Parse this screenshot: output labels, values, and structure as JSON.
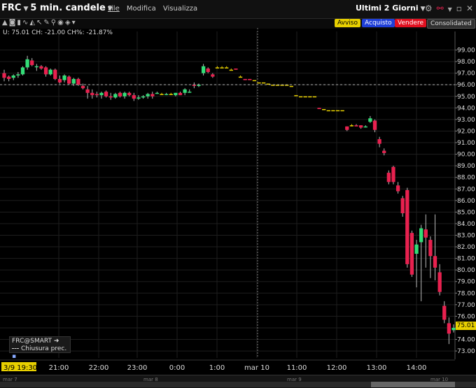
{
  "header": {
    "symbol": "FRC",
    "bar_size": "5 min. candele",
    "menus": [
      "File",
      "Modifica",
      "Visualizza"
    ],
    "range": "Ultimi 2 Giorni"
  },
  "buttons": {
    "alert": "Avviso",
    "buy": "Acquisto",
    "sell": "Vendere",
    "consolidated": "Consolidated"
  },
  "status": "U: 75.01 CH: -21.00 CH%: -21.87%",
  "legend": {
    "contract": "FRC@SMART",
    "prev_close": "Chiusura prec."
  },
  "current_price_label": "75.01",
  "colors": {
    "up": "#33dd77",
    "down": "#e8214f",
    "doji": "#e8d000",
    "background": "#000000",
    "grid": "#1e1e1e"
  },
  "icons": [
    "crosshair-icon",
    "zoom-icon",
    "bar-icon",
    "line-icon",
    "mountain-icon",
    "pointer-icon",
    "wrench-icon",
    "draw-icon",
    "eye-icon",
    "layout-icon"
  ],
  "timeline": [
    "mar 7",
    "mar 8",
    "mar 9",
    "mar 10"
  ],
  "chart_data": {
    "type": "candlestick",
    "ylim": [
      72.4,
      100.0
    ],
    "y_ticks": [
      "73.00",
      "74.00",
      "75.00",
      "76.00",
      "77.00",
      "78.00",
      "79.00",
      "80.00",
      "81.00",
      "82.00",
      "83.00",
      "84.00",
      "85.00",
      "86.00",
      "87.00",
      "88.00",
      "89.00",
      "90.00",
      "91.00",
      "92.00",
      "93.00",
      "94.00",
      "95.00",
      "96.00",
      "97.00",
      "98.00",
      "99.00"
    ],
    "x_labels": [
      "3/9 19:30",
      "21:00",
      "22:00",
      "23:00",
      "0:00",
      "1:00",
      "mar 10",
      "11:00",
      "12:00",
      "13:00",
      "14:00"
    ],
    "previous_close": 96.01,
    "current_price": 75.01,
    "ohlc": [
      [
        97.0,
        97.3,
        96.3,
        96.6
      ],
      [
        96.7,
        96.8,
        96.3,
        96.5
      ],
      [
        96.6,
        96.9,
        96.4,
        96.8
      ],
      [
        96.8,
        97.1,
        96.6,
        96.9
      ],
      [
        96.9,
        97.6,
        96.8,
        97.5
      ],
      [
        97.5,
        98.5,
        97.3,
        98.2
      ],
      [
        98.1,
        98.3,
        97.6,
        97.7
      ],
      [
        97.6,
        97.8,
        97.2,
        97.6
      ],
      [
        97.6,
        97.7,
        97.3,
        97.4
      ],
      [
        97.5,
        97.6,
        96.7,
        96.9
      ],
      [
        96.9,
        97.4,
        96.8,
        97.3
      ],
      [
        97.3,
        97.4,
        96.4,
        96.5
      ],
      [
        96.5,
        96.8,
        96.1,
        96.2
      ],
      [
        96.4,
        96.9,
        96.2,
        96.8
      ],
      [
        96.7,
        96.8,
        96.0,
        96.1
      ],
      [
        96.1,
        96.6,
        95.9,
        96.5
      ],
      [
        96.5,
        96.6,
        95.9,
        96.0
      ],
      [
        95.9,
        96.1,
        95.6,
        95.7
      ],
      [
        95.6,
        95.9,
        94.8,
        95.3
      ],
      [
        95.3,
        95.6,
        94.8,
        95.1
      ],
      [
        95.2,
        95.4,
        94.9,
        95.1
      ],
      [
        95.1,
        95.4,
        94.8,
        95.3
      ],
      [
        95.4,
        95.5,
        94.9,
        95.0
      ],
      [
        95.0,
        95.3,
        94.7,
        94.9
      ],
      [
        94.9,
        95.3,
        94.8,
        95.2
      ],
      [
        95.3,
        95.4,
        94.9,
        95.0
      ],
      [
        95.0,
        95.4,
        94.8,
        95.3
      ],
      [
        95.3,
        95.4,
        95.0,
        95.1
      ],
      [
        95.1,
        95.3,
        94.6,
        94.8
      ],
      [
        94.8,
        95.1,
        94.7,
        94.9
      ],
      [
        94.9,
        95.1,
        94.8,
        95.0
      ],
      [
        95.0,
        95.3,
        94.8,
        95.2
      ],
      [
        95.2,
        95.4,
        94.8,
        95.0
      ],
      [
        95.3,
        95.4,
        95.2,
        95.3
      ],
      [
        95.2,
        95.3,
        95.2,
        95.2
      ],
      [
        95.2,
        95.3,
        95.1,
        95.2
      ],
      [
        95.2,
        95.3,
        95.2,
        95.2
      ],
      [
        95.1,
        95.3,
        95.0,
        95.3
      ],
      [
        95.3,
        95.4,
        95.1,
        95.1
      ],
      [
        95.3,
        95.7,
        95.1,
        95.6
      ],
      [
        95.4,
        95.6,
        95.3,
        95.4
      ],
      [
        96.0,
        96.2,
        95.7,
        95.9
      ],
      [
        95.9,
        96.1,
        95.8,
        96.0
      ],
      [
        97.0,
        97.8,
        96.8,
        97.6
      ],
      [
        97.4,
        97.5,
        97.0,
        97.1
      ],
      [
        96.9,
        97.0,
        96.6,
        96.7
      ],
      [
        97.5,
        97.6,
        97.5,
        97.5
      ],
      [
        97.5,
        97.6,
        97.5,
        97.5
      ],
      [
        97.5,
        97.6,
        97.5,
        97.5
      ],
      [
        97.3,
        97.4,
        97.3,
        97.3
      ],
      [
        97.4,
        97.4,
        97.3,
        97.3
      ],
      [
        96.7,
        96.8,
        96.7,
        96.7
      ],
      [
        96.5,
        96.5,
        96.4,
        96.4
      ],
      [
        96.5,
        96.5,
        96.4,
        96.4
      ],
      [
        96.4,
        96.4,
        96.4,
        96.4
      ],
      [
        96.2,
        96.2,
        96.2,
        96.2
      ],
      [
        96.2,
        96.2,
        96.2,
        96.2
      ],
      [
        96.1,
        96.1,
        96.1,
        96.1
      ],
      [
        96.0,
        96.0,
        96.0,
        96.0
      ],
      [
        96.0,
        96.0,
        96.0,
        96.0
      ],
      [
        96.0,
        96.0,
        96.0,
        96.0
      ],
      [
        96.0,
        96.0,
        96.0,
        96.0
      ],
      [
        95.9,
        95.9,
        95.9,
        95.9
      ],
      [
        95.1,
        95.1,
        95.1,
        95.1
      ],
      [
        95.0,
        95.0,
        95.0,
        95.0
      ],
      [
        95.0,
        95.0,
        95.0,
        95.0
      ],
      [
        95.0,
        95.0,
        95.0,
        95.0
      ],
      [
        95.0,
        95.0,
        95.0,
        95.0
      ],
      [
        94.0,
        94.0,
        93.9,
        93.9
      ],
      [
        93.9,
        93.9,
        93.9,
        93.9
      ],
      [
        93.8,
        93.8,
        93.8,
        93.8
      ],
      [
        93.8,
        93.8,
        93.8,
        93.8
      ],
      [
        93.8,
        93.8,
        93.8,
        93.8
      ],
      [
        93.8,
        93.8,
        93.8,
        93.8
      ],
      [
        92.4,
        92.4,
        92.0,
        92.1
      ],
      [
        92.5,
        92.6,
        92.4,
        92.5
      ],
      [
        92.5,
        92.6,
        92.4,
        92.4
      ],
      [
        92.5,
        92.5,
        92.2,
        92.3
      ],
      [
        92.4,
        92.5,
        92.3,
        92.4
      ],
      [
        92.8,
        93.3,
        92.7,
        93.1
      ],
      [
        92.9,
        93.0,
        91.9,
        92.1
      ],
      [
        91.3,
        91.5,
        90.6,
        90.9
      ],
      [
        90.3,
        90.5,
        89.9,
        90.1
      ],
      [
        88.4,
        88.6,
        87.4,
        87.6
      ],
      [
        88.9,
        89.0,
        87.4,
        87.6
      ],
      [
        87.3,
        87.6,
        86.6,
        86.8
      ],
      [
        86.2,
        86.4,
        84.6,
        84.9
      ],
      [
        86.9,
        87.1,
        80.2,
        80.5
      ],
      [
        83.2,
        83.4,
        79.4,
        79.6
      ],
      [
        81.4,
        82.6,
        78.5,
        82.2
      ],
      [
        82.4,
        83.9,
        77.3,
        83.6
      ],
      [
        83.5,
        84.8,
        80.2,
        82.8
      ],
      [
        82.6,
        82.9,
        79.3,
        81.2
      ],
      [
        81.2,
        84.8,
        79.1,
        80.2
      ],
      [
        79.8,
        80.5,
        77.8,
        78.1
      ],
      [
        76.9,
        77.3,
        75.4,
        75.7
      ],
      [
        75.4,
        75.9,
        73.6,
        74.5
      ],
      [
        74.8,
        75.3,
        74.6,
        75.0
      ]
    ]
  }
}
